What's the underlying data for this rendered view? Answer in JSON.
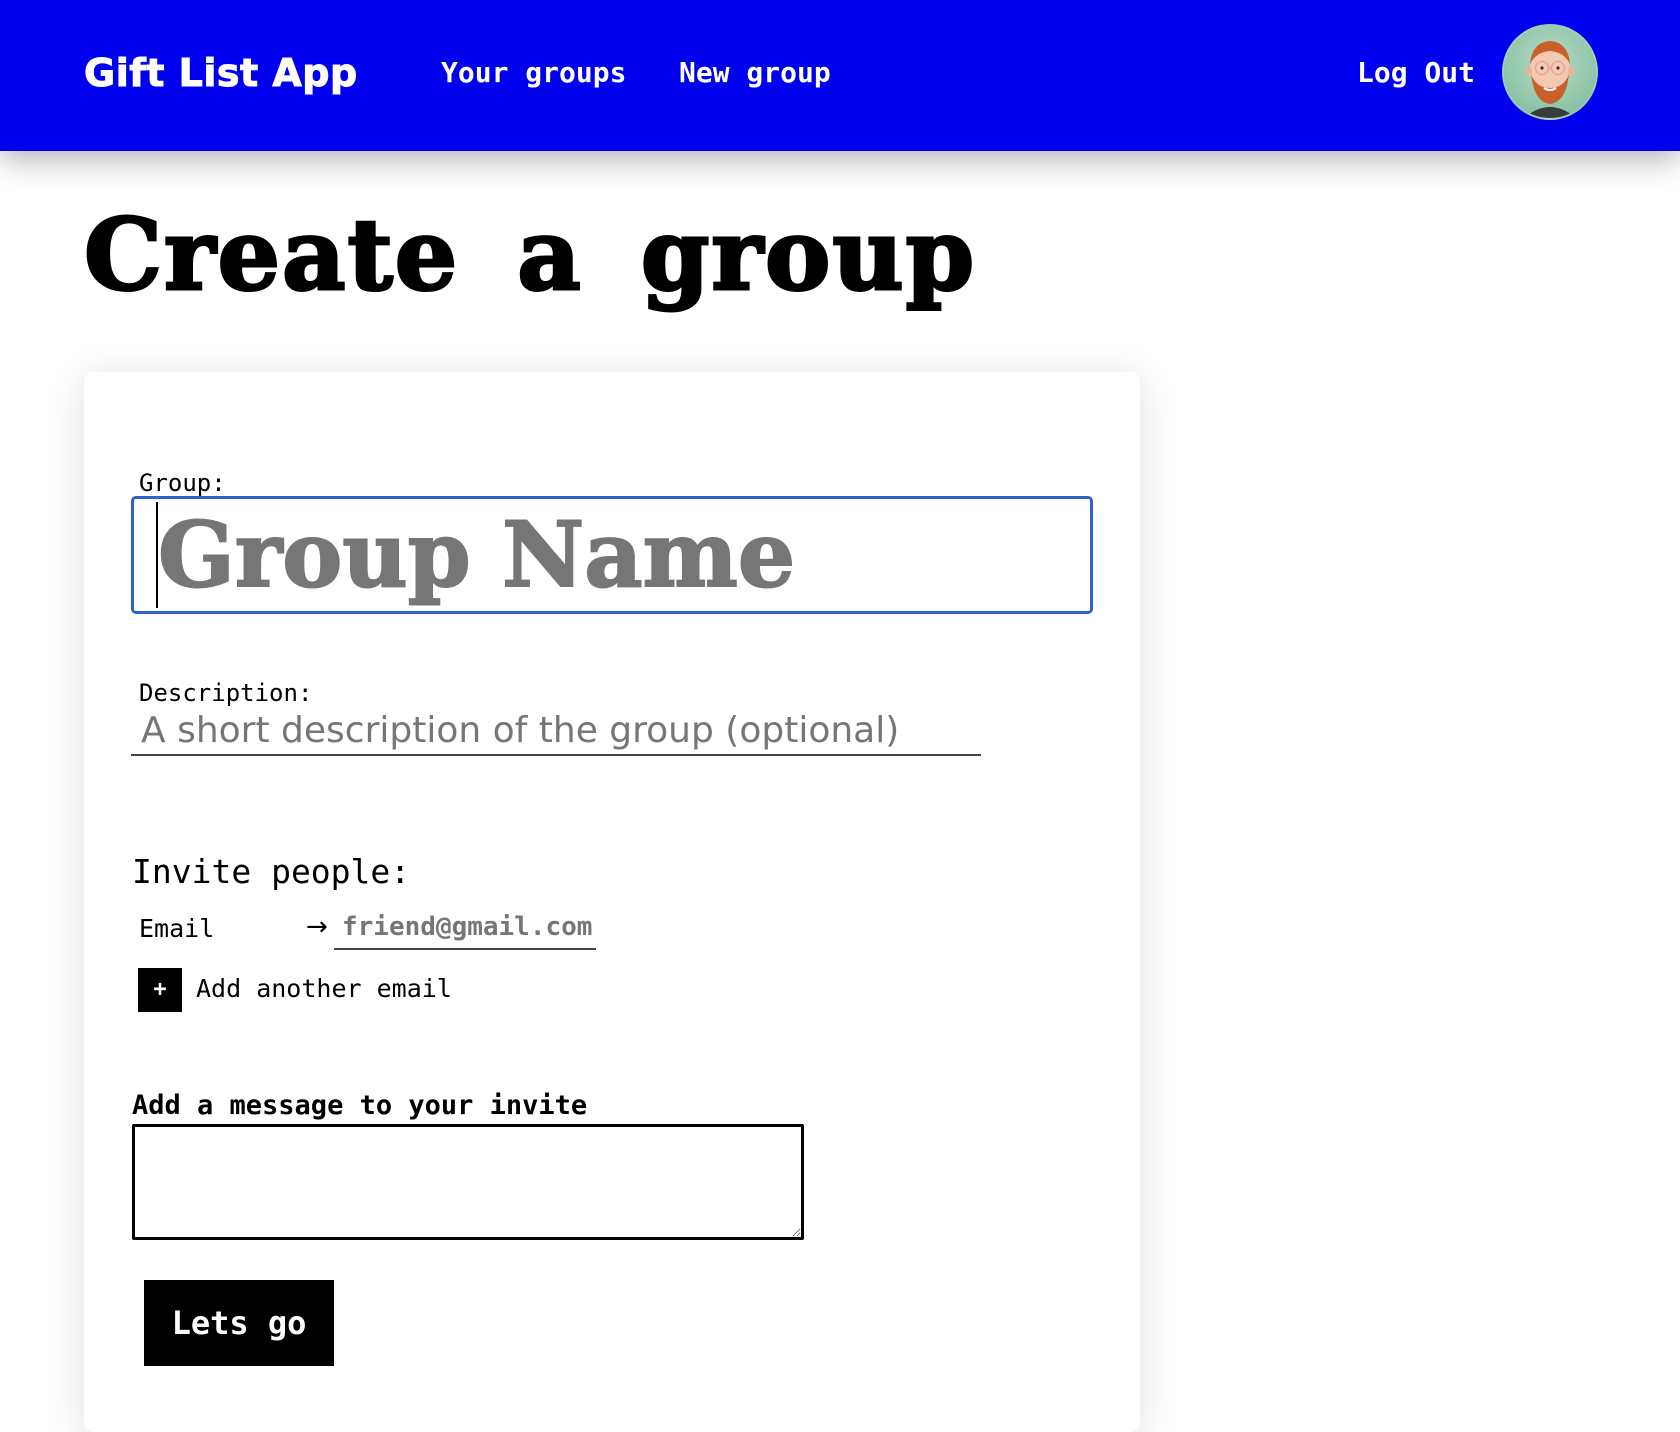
{
  "nav": {
    "brand": "Gift List App",
    "your_groups": "Your groups",
    "new_group": "New group",
    "logout": "Log Out"
  },
  "page": {
    "title": "Create a group"
  },
  "form": {
    "group_label": "Group:",
    "group_placeholder": "Group Name",
    "description_label": "Description:",
    "description_placeholder": "A short description of the group (optional)",
    "invite_heading": "Invite people:",
    "email_label": "Email",
    "email_arrow": "→",
    "email_placeholder": "friend@gmail.com",
    "add_email_symbol": "+",
    "add_email_label": "Add another email",
    "message_label": "Add a message to your invite",
    "message_value": "",
    "submit_label": "Lets go"
  },
  "colors": {
    "nav_background": "#0000ee",
    "focus_ring": "#2f62c9",
    "placeholder": "#767676"
  },
  "icons": {
    "avatar": "user-avatar-illustration",
    "add": "plus-icon",
    "arrow": "right-arrow-icon"
  }
}
